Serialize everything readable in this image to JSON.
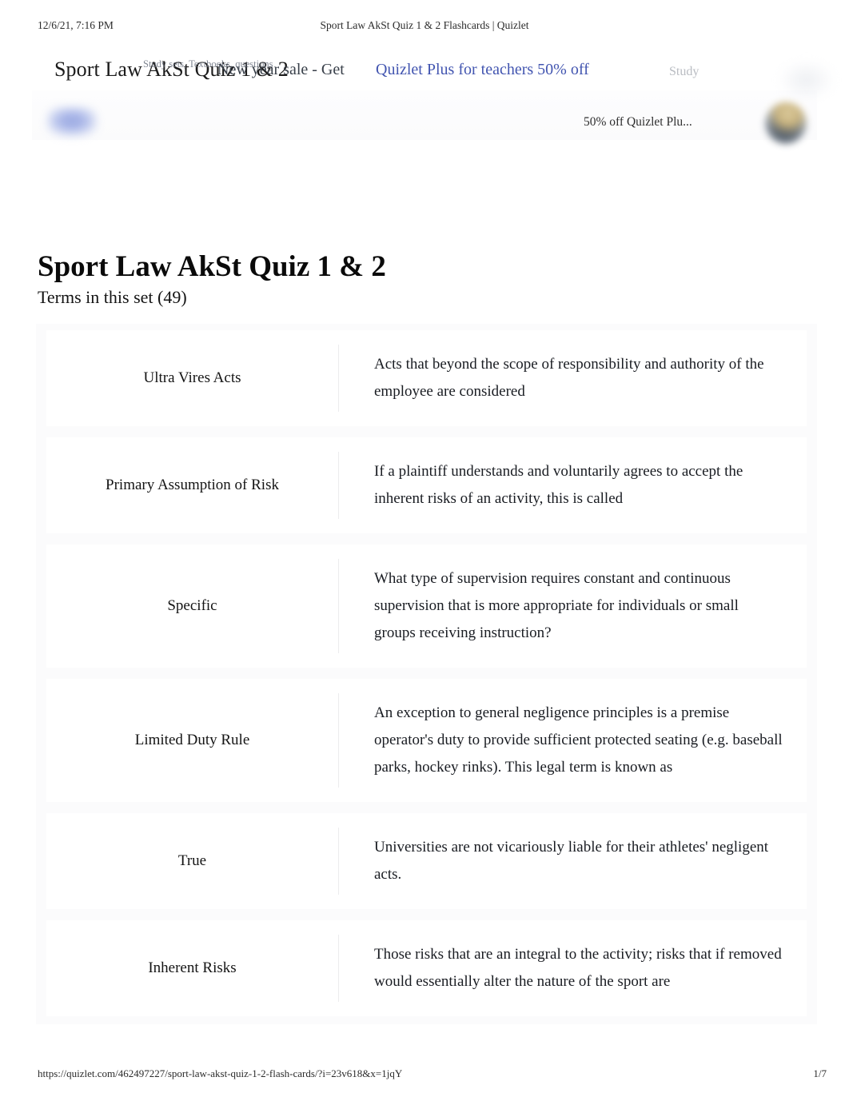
{
  "print_header": {
    "left": "12/6/21, 7:16 PM",
    "center": "Sport Law AkSt Quiz 1 & 2 Flashcards | Quizlet"
  },
  "print_footer": {
    "url": "https://quizlet.com/462497227/sport-law-akst-quiz-1-2-flash-cards/?i=23v618&x=1jqY",
    "page": "1/7"
  },
  "site_chrome": {
    "page_title_top": "Sport Law AkSt Quiz 1 & 2",
    "nav_links": "Study sets, Textbooks, questions",
    "promo_text": "New year sale - Get",
    "promo_link": "Quizlet Plus for teachers 50% off",
    "nav_study": "Study",
    "banner_note": "50% off Quizlet Plu...",
    "colors": {
      "link": "#4255b0",
      "muted": "#6b7280",
      "study_gray": "#b9bcc2"
    }
  },
  "main": {
    "set_title": "Sport Law AkSt Quiz 1 & 2",
    "terms_count_label": "Terms in this set (49)",
    "cards": [
      {
        "term": "Ultra Vires Acts",
        "definition": "Acts that beyond the scope of responsibility and authority of the employee are considered"
      },
      {
        "term": "Primary Assumption of Risk",
        "definition": "If a plaintiff understands and voluntarily agrees to accept the inherent risks of an activity, this is called"
      },
      {
        "term": "Specific",
        "definition": "What type of supervision requires constant and continuous supervision that is more appropriate for individuals or small groups receiving instruction?"
      },
      {
        "term": "Limited Duty Rule",
        "definition": "An exception to general negligence principles is a premise operator's duty to provide sufficient protected seating (e.g. baseball parks, hockey rinks). This legal term is known as"
      },
      {
        "term": "True",
        "definition": "Universities are not vicariously liable for their athletes' negligent acts."
      },
      {
        "term": "Inherent Risks",
        "definition": "Those risks that are an integral to the activity; risks that if removed would essentially alter the nature of the sport are"
      }
    ]
  }
}
